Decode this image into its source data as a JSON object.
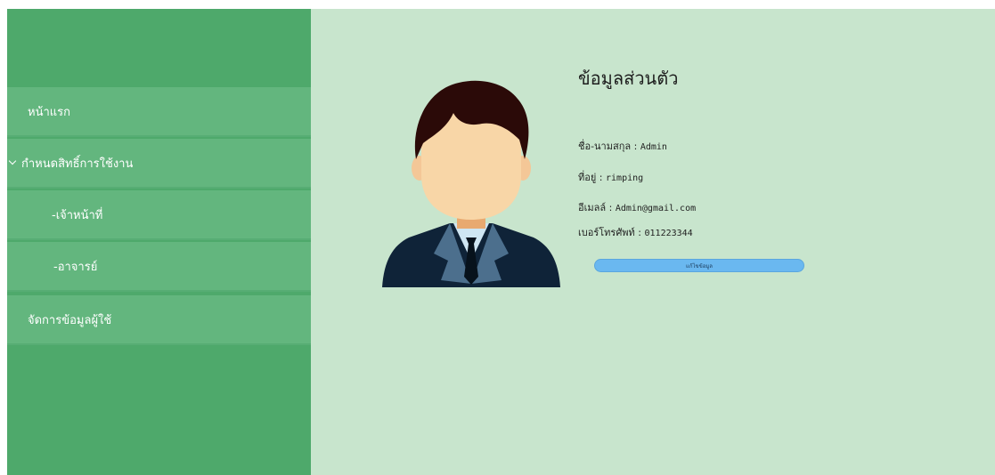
{
  "sidebar": {
    "items": [
      {
        "label": "หน้าแรก"
      },
      {
        "label": "กำหนดสิทธิ์การใช้งาน"
      },
      {
        "label": "-เจ้าหน้าที่"
      },
      {
        "label": "-อาจารย์"
      },
      {
        "label": "จัดการข้อมูลผู้ใช้"
      }
    ]
  },
  "profile": {
    "title": "ข้อมูลส่วนตัว",
    "fields": [
      {
        "label": "ชื่อ-นามสกุล :",
        "value": "Admin"
      },
      {
        "label": "ที่อยู่ :",
        "value": "rimping"
      },
      {
        "label": "อีเมลล์ :",
        "value": "Admin@gmail.com"
      },
      {
        "label": "เบอร์โทรศัพท์ :",
        "value": "011223344"
      }
    ],
    "edit_button": "แก้ไขข้อมูล"
  },
  "colors": {
    "sidebar_bg": "#4ea96b",
    "sidebar_item_bg": "#63b67e",
    "main_bg": "#c8e5cd",
    "button_bg": "#6ab8f0"
  },
  "icons": {
    "avatar": "businessman-avatar-icon",
    "expand": "chevron-down-icon"
  }
}
